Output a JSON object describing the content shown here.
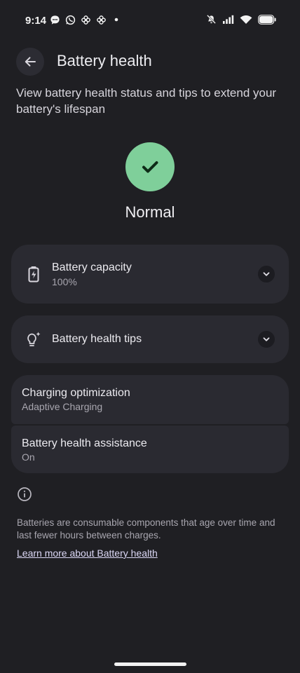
{
  "statusbar": {
    "time": "9:14",
    "left_icons": [
      "message-icon",
      "whatsapp-icon",
      "pinwheel-icon",
      "pinwheel-icon",
      "dot-icon"
    ],
    "right_icons": [
      "mute-icon",
      "signal-icon",
      "wifi-icon",
      "battery-icon"
    ]
  },
  "header": {
    "title": "Battery health",
    "back_icon": "arrow-back-icon"
  },
  "subtitle": "View battery health status and tips to extend your battery's lifespan",
  "status": {
    "label": "Normal",
    "icon": "checkmark-icon",
    "color": "#7fcf9a"
  },
  "cards": {
    "capacity": {
      "title": "Battery capacity",
      "value": "100%",
      "icon": "battery-charging-icon"
    },
    "tips": {
      "title": "Battery health tips",
      "icon": "lightbulb-sparkle-icon"
    },
    "charging": {
      "title": "Charging optimization",
      "value": "Adaptive Charging"
    },
    "assistance": {
      "title": "Battery health assistance",
      "value": "On"
    }
  },
  "footer": {
    "note": "Batteries are consumable components that age over time and last fewer hours between charges.",
    "link": "Learn more about Battery health"
  },
  "colors": {
    "background": "#1f1f23",
    "card": "#2a2a31",
    "accent_green": "#7fcf9a",
    "link": "#dcd8f6"
  }
}
